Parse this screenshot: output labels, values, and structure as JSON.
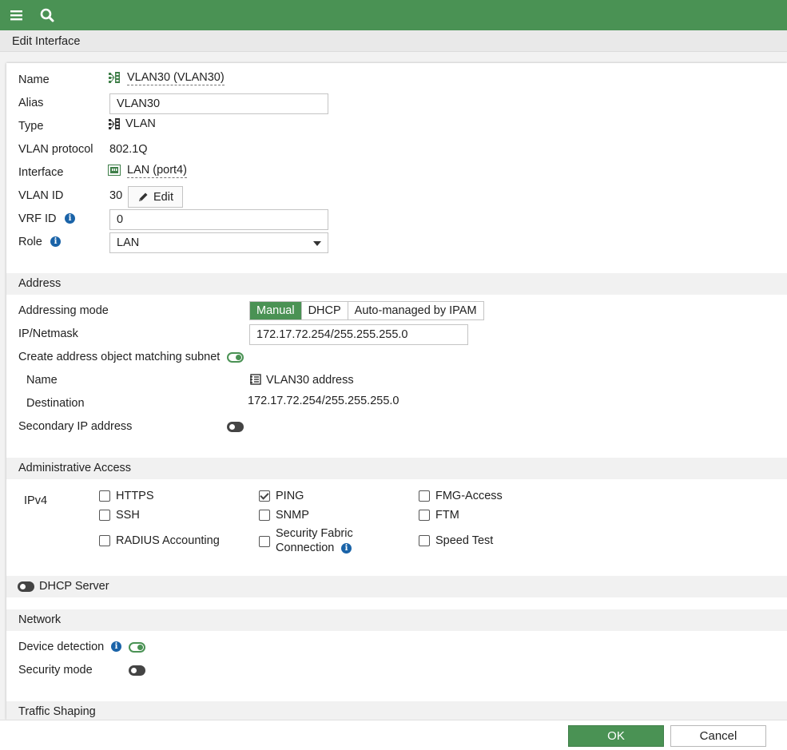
{
  "header": {
    "menu_icon": "hamburger-icon",
    "search_icon": "search-icon",
    "title": "Edit Interface",
    "accent_color": "#4a9254"
  },
  "general": {
    "name_label": "Name",
    "name_value": "VLAN30 (VLAN30)",
    "alias_label": "Alias",
    "alias_value": "VLAN30",
    "type_label": "Type",
    "type_value": "VLAN",
    "vlan_protocol_label": "VLAN protocol",
    "vlan_protocol_value": "802.1Q",
    "interface_label": "Interface",
    "interface_value": "LAN (port4)",
    "vlan_id_label": "VLAN ID",
    "vlan_id_value": "30",
    "edit_label": "Edit",
    "vrf_id_label": "VRF ID",
    "vrf_id_value": "0",
    "role_label": "Role",
    "role_value": "LAN"
  },
  "address": {
    "section_title": "Address",
    "addressing_mode_label": "Addressing mode",
    "modes": [
      "Manual",
      "DHCP",
      "Auto-managed by IPAM"
    ],
    "selected_mode": "Manual",
    "ip_netmask_label": "IP/Netmask",
    "ip_netmask_value": "172.17.72.254/255.255.255.0",
    "create_object_label": "Create address object matching subnet",
    "create_object_enabled": true,
    "object_name_label": "Name",
    "object_name_value": "VLAN30 address",
    "destination_label": "Destination",
    "destination_value": "172.17.72.254/255.255.255.0",
    "secondary_ip_label": "Secondary IP address",
    "secondary_ip_enabled": false
  },
  "admin_access": {
    "section_title": "Administrative Access",
    "ipv4_label": "IPv4",
    "options": [
      {
        "label": "HTTPS",
        "checked": false
      },
      {
        "label": "PING",
        "checked": true
      },
      {
        "label": "FMG-Access",
        "checked": false
      },
      {
        "label": "SSH",
        "checked": false
      },
      {
        "label": "SNMP",
        "checked": false
      },
      {
        "label": "FTM",
        "checked": false
      },
      {
        "label": "RADIUS Accounting",
        "checked": false
      },
      {
        "label_line1": "Security Fabric",
        "label_line2": "Connection",
        "checked": false
      },
      {
        "label": "Speed Test",
        "checked": false
      }
    ]
  },
  "dhcp_server": {
    "label": "DHCP Server",
    "enabled": false
  },
  "network": {
    "section_title": "Network",
    "device_detection_label": "Device detection",
    "device_detection_enabled": true,
    "security_mode_label": "Security mode",
    "security_mode_enabled": false
  },
  "traffic_shaping": {
    "section_title": "Traffic Shaping"
  },
  "footer": {
    "ok_label": "OK",
    "cancel_label": "Cancel"
  }
}
